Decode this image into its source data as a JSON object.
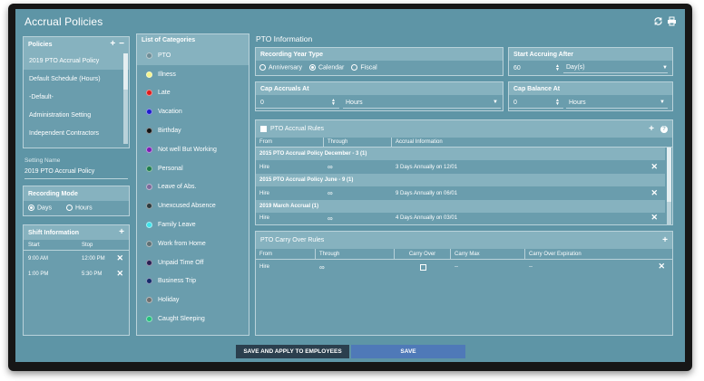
{
  "app": {
    "title": "Accrual Policies"
  },
  "policies": {
    "header": "Policies",
    "items": [
      "2019 PTO Accrual Policy",
      "Default Schedule (Hours)",
      "-Default-",
      "Administration Setting",
      "Independent Contractors"
    ]
  },
  "setting_name": {
    "label": "Setting Name",
    "value": "2019 PTO Accrual Policy"
  },
  "recording_mode": {
    "header": "Recording Mode",
    "options": [
      "Days",
      "Hours"
    ],
    "selected": "Days"
  },
  "shift_info": {
    "header": "Shift Information",
    "columns": [
      "Start",
      "Stop"
    ],
    "rows": [
      {
        "start": "9:00 AM",
        "stop": "12:00 PM"
      },
      {
        "start": "1:00 PM",
        "stop": "5:30 PM"
      }
    ]
  },
  "categories": {
    "header": "List of Categories",
    "items": [
      {
        "label": "PTO",
        "color": "#6f8e98"
      },
      {
        "label": "Illness",
        "color": "#f4f48c"
      },
      {
        "label": "Late",
        "color": "#e01b1b"
      },
      {
        "label": "Vacation",
        "color": "#1c1ccf"
      },
      {
        "label": "Birthday",
        "color": "#111111"
      },
      {
        "label": "Not well But Working",
        "color": "#7b1bb3"
      },
      {
        "label": "Personal",
        "color": "#1e7d4b"
      },
      {
        "label": "Leave of Abs.",
        "color": "#7d6a9a"
      },
      {
        "label": "Unexcused Absence",
        "color": "#2c3a3e"
      },
      {
        "label": "Family Leave",
        "color": "#3de3ea"
      },
      {
        "label": "Work from Home",
        "color": "#5f7074"
      },
      {
        "label": "Unpaid Time Off",
        "color": "#2a1f52"
      },
      {
        "label": "Business Trip",
        "color": "#14296b"
      },
      {
        "label": "Holiday",
        "color": "#6f6f6f"
      },
      {
        "label": "Caught Sleeping",
        "color": "#23c07b"
      }
    ]
  },
  "pto_info": {
    "title": "PTO Information",
    "recording_year_type": {
      "label": "Recording Year Type",
      "options": [
        "Anniversary",
        "Calendar",
        "Fiscal"
      ],
      "selected": "Calendar"
    },
    "start_accruing": {
      "label": "Start Accruing After",
      "value": "60",
      "unit": "Day(s)"
    },
    "cap_accruals": {
      "label": "Cap Accruals At",
      "value": "0",
      "unit": "Hours"
    },
    "cap_balance": {
      "label": "Cap Balance At",
      "value": "0",
      "unit": "Hours"
    }
  },
  "accrual_rules": {
    "header": "PTO Accrual Rules",
    "columns": [
      "From",
      "Through",
      "Accrual Information"
    ],
    "groups": [
      {
        "title": "2015 PTO Accrual Policy December - 3 (1)",
        "row": {
          "from": "Hire",
          "through": "∞",
          "info": "3 Days Annually on 12/01"
        }
      },
      {
        "title": "2015 PTO Accrual Policy June - 9 (1)",
        "row": {
          "from": "Hire",
          "through": "∞",
          "info": "9 Days Annually on 06/01"
        }
      },
      {
        "title": "2019 March Accrual (1)",
        "row": {
          "from": "Hire",
          "through": "∞",
          "info": "4 Days Annually on 03/01"
        }
      }
    ]
  },
  "carry_over": {
    "header": "PTO Carry Over Rules",
    "columns": [
      "From",
      "Through",
      "Carry Over",
      "Carry Max",
      "Carry Over Expiration"
    ],
    "row": {
      "from": "Hire",
      "through": "∞",
      "carry_max": "--",
      "expiration": "--"
    }
  },
  "buttons": {
    "save_apply": "SAVE AND APPLY TO EMPLOYEES",
    "save": "SAVE"
  },
  "colors": {
    "background": "#5e95a6",
    "panel_header": "#86b2bf",
    "dark_button": "#2b3f4e",
    "save_button": "#4f79b8"
  }
}
